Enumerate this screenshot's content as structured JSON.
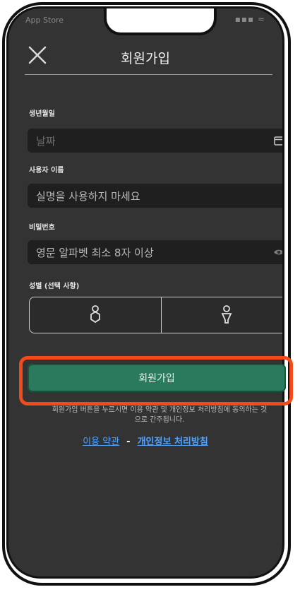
{
  "status_bar": {
    "carrier": "App Store",
    "signal": "▪▪▪ ≈"
  },
  "header": {
    "title": "회원가입",
    "close_icon": "close-icon"
  },
  "fields": {
    "birthdate": {
      "label": "생년월일",
      "placeholder": "날짜",
      "icon": "calendar-icon"
    },
    "username": {
      "label": "사용자 이름",
      "placeholder": "실명을 사용하지 마세요"
    },
    "password": {
      "label": "비밀번호",
      "placeholder": "영문 알파벳 최소 8자 이상",
      "icon": "eye-icon"
    },
    "gender": {
      "label": "성별 (선택 사항)",
      "options": [
        "male-icon",
        "female-icon"
      ]
    }
  },
  "signup_button": {
    "label": "회원가입"
  },
  "terms": {
    "notice": "회원가입 버튼을 누르시면 이용 약관 및 개인정보 처리방침에 동의하는 것으로 간주됩니다.",
    "terms_link": "이용 약관",
    "separator": "-",
    "privacy_link": "개인정보 처리방침"
  },
  "colors": {
    "screen_bg": "#333333",
    "field_bg": "#1f1f1f",
    "button_bg": "#2a7a5d",
    "highlight": "#f24a1a",
    "link": "#4fa3ff"
  }
}
